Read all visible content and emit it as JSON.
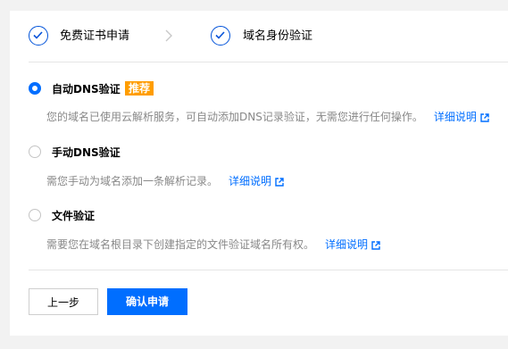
{
  "steps": [
    {
      "label": "免费证书申请",
      "status": "done"
    },
    {
      "label": "域名身份验证",
      "status": "done"
    }
  ],
  "icons": {
    "step_check": "check-icon",
    "step_arrow": "chevron-right-icon",
    "external_link": "external-link-icon"
  },
  "colors": {
    "primary": "#006eff",
    "step_border": "#0052d9",
    "badge": "#ff9d00",
    "muted_text": "#888888"
  },
  "options": [
    {
      "title": "自动DNS验证",
      "badge": "推荐",
      "description": "您的域名已使用云解析服务，可自动添加DNS记录验证，无需您进行任何操作。",
      "link": "详细说明",
      "selected": true
    },
    {
      "title": "手动DNS验证",
      "description": "需您手动为域名添加一条解析记录。",
      "link": "详细说明",
      "selected": false
    },
    {
      "title": "文件验证",
      "description": "需要您在域名根目录下创建指定的文件验证域名所有权。",
      "link": "详细说明",
      "selected": false
    }
  ],
  "buttons": {
    "prev": "上一步",
    "confirm": "确认申请"
  }
}
